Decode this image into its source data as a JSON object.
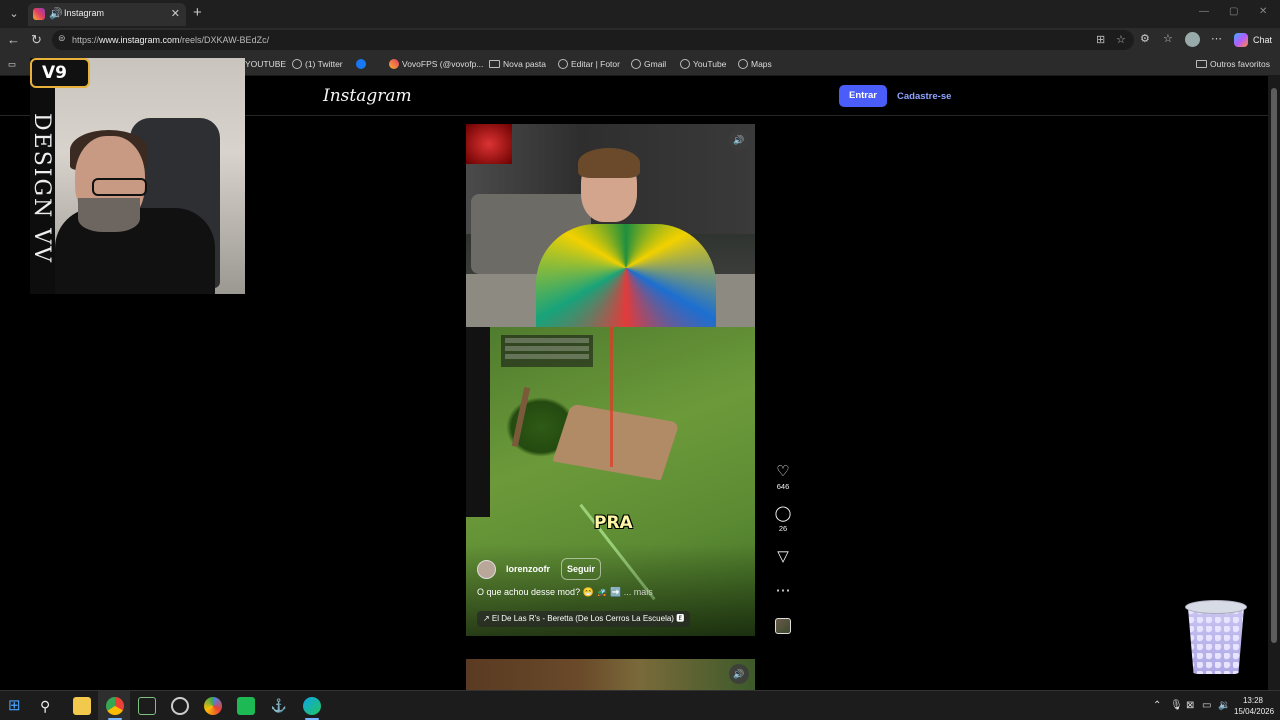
{
  "browser": {
    "tab": {
      "title": "Instagram"
    },
    "address": {
      "url_prefix": "https://",
      "url_host": "www.instagram.com",
      "url_path": "/reels/DXKAW-BEdZc/"
    },
    "chat_label": "Chat",
    "bookmarks": [
      {
        "label": "YOUTUBE"
      },
      {
        "label": "(1) Twitter"
      },
      {
        "label": "VovoFPS (@vovofp..."
      },
      {
        "label": "Nova pasta"
      },
      {
        "label": "Editar | Fotor"
      },
      {
        "label": "Gmail"
      },
      {
        "label": "YouTube"
      },
      {
        "label": "Maps"
      }
    ],
    "other_bookmarks": "Outros favoritos"
  },
  "instagram": {
    "logo": "Instagram",
    "login_button": "Entrar",
    "signup_link": "Cadastre-se",
    "reel": {
      "overlay_text": "PRA",
      "author": "lorenzoofr",
      "follow_button": "Seguir",
      "caption": "O que achou desse mod? 😁 🚜 ➡️",
      "caption_more": "... mais",
      "music": "↗ El De Las R's - Beretta (De Los Cerros La Escuela) 🅴"
    },
    "actions": {
      "likes": "646",
      "comments": "26"
    }
  },
  "overlay": {
    "logo_text": "V9",
    "vertical_text": "DESIGN VV"
  },
  "taskbar": {
    "time": "13:28",
    "date": "15/04/2026"
  }
}
